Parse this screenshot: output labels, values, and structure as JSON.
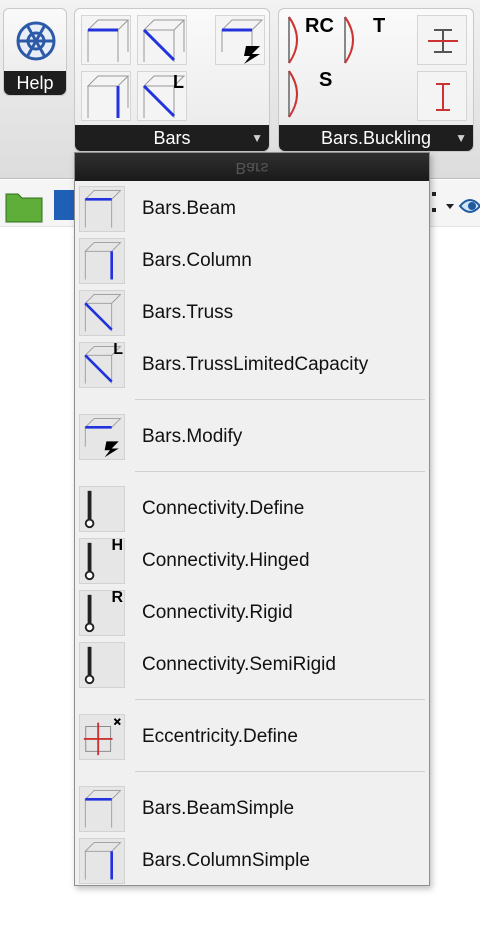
{
  "ribbon": {
    "help_label": "Help",
    "bars_group_label": "Bars",
    "buckling_group_label": "Bars.Buckling",
    "buckling_tags": {
      "rc": "RC",
      "t": "T",
      "s": "S"
    },
    "bars_badge_l": "L",
    "icons": {
      "help": "help-wheel-icon",
      "beam": "bars-beam-icon",
      "column": "bars-column-icon",
      "truss": "bars-truss-icon",
      "truss_limited": "bars-truss-limited-icon",
      "modify": "bars-modify-icon"
    }
  },
  "menu": {
    "header_label": "Bars",
    "items": [
      {
        "label": "Bars.Beam",
        "icon": "bars-beam-icon"
      },
      {
        "label": "Bars.Column",
        "icon": "bars-column-icon"
      },
      {
        "label": "Bars.Truss",
        "icon": "bars-truss-icon"
      },
      {
        "label": "Bars.TrussLimitedCapacity",
        "icon": "bars-truss-limited-icon",
        "badge": "L"
      },
      {
        "label": "Bars.Modify",
        "icon": "bars-modify-icon"
      },
      {
        "label": "Connectivity.Define",
        "icon": "connectivity-define-icon"
      },
      {
        "label": "Connectivity.Hinged",
        "icon": "connectivity-hinged-icon",
        "badge": "H"
      },
      {
        "label": "Connectivity.Rigid",
        "icon": "connectivity-rigid-icon",
        "badge": "R"
      },
      {
        "label": "Connectivity.SemiRigid",
        "icon": "connectivity-semirigid-icon"
      },
      {
        "label": "Eccentricity.Define",
        "icon": "eccentricity-define-icon"
      },
      {
        "label": "Bars.BeamSimple",
        "icon": "bars-beam-simple-icon"
      },
      {
        "label": "Bars.ColumnSimple",
        "icon": "bars-column-simple-icon"
      }
    ]
  },
  "colors": {
    "bar_blue": "#2233dd",
    "buckling_red": "#cc3333",
    "group_label_bg": "#1e1e1e"
  }
}
